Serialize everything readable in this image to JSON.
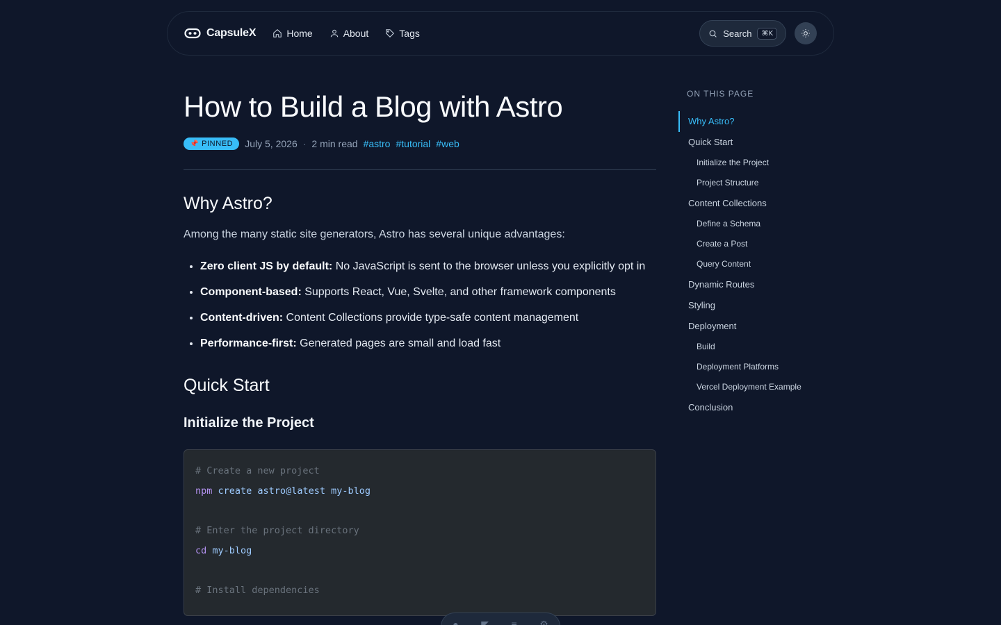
{
  "header": {
    "brand": "CapsuleX",
    "nav": [
      {
        "label": "Home",
        "icon": "home-icon"
      },
      {
        "label": "About",
        "icon": "user-icon"
      },
      {
        "label": "Tags",
        "icon": "tag-icon"
      }
    ],
    "search_label": "Search",
    "search_shortcut": "⌘K",
    "theme_icon": "sun-icon"
  },
  "article": {
    "title": "How to Build a Blog with Astro",
    "pinned_label": "PINNED",
    "date": "July 5, 2026",
    "separator": "·",
    "read_time": "2 min read",
    "tags": [
      "#astro",
      "#tutorial",
      "#web"
    ],
    "section1_heading": "Why Astro?",
    "section1_lead": "Among the many static site generators, Astro has several unique advantages:",
    "features": [
      {
        "bold": "Zero client JS by default:",
        "text": " No JavaScript is sent to the browser unless you explicitly opt in"
      },
      {
        "bold": "Component-based:",
        "text": " Supports React, Vue, Svelte, and other framework components"
      },
      {
        "bold": "Content-driven:",
        "text": " Content Collections provide type-safe content management"
      },
      {
        "bold": "Performance-first:",
        "text": " Generated pages are small and load fast"
      }
    ],
    "section2_heading": "Quick Start",
    "subsection_heading": "Initialize the Project",
    "code": {
      "comment1": "# Create a new project",
      "line1_cmd": "npm",
      "line1_args": "create astro@latest my-blog",
      "comment2": "# Enter the project directory",
      "line2_cmd": "cd",
      "line2_args": "my-blog",
      "comment3": "# Install dependencies"
    }
  },
  "toc": {
    "title": "ON THIS PAGE",
    "items": [
      {
        "label": "Why Astro?",
        "level": 2,
        "active": true
      },
      {
        "label": "Quick Start",
        "level": 2
      },
      {
        "label": "Initialize the Project",
        "level": 3
      },
      {
        "label": "Project Structure",
        "level": 3
      },
      {
        "label": "Content Collections",
        "level": 2
      },
      {
        "label": "Define a Schema",
        "level": 3
      },
      {
        "label": "Create a Post",
        "level": 3
      },
      {
        "label": "Query Content",
        "level": 3
      },
      {
        "label": "Dynamic Routes",
        "level": 2
      },
      {
        "label": "Styling",
        "level": 2
      },
      {
        "label": "Deployment",
        "level": 2
      },
      {
        "label": "Build",
        "level": 3
      },
      {
        "label": "Deployment Platforms",
        "level": 3
      },
      {
        "label": "Vercel Deployment Example",
        "level": 3
      },
      {
        "label": "Conclusion",
        "level": 2
      }
    ]
  },
  "colors": {
    "background": "#0f172a",
    "accent": "#38bdf8",
    "code_bg": "#24292e"
  }
}
